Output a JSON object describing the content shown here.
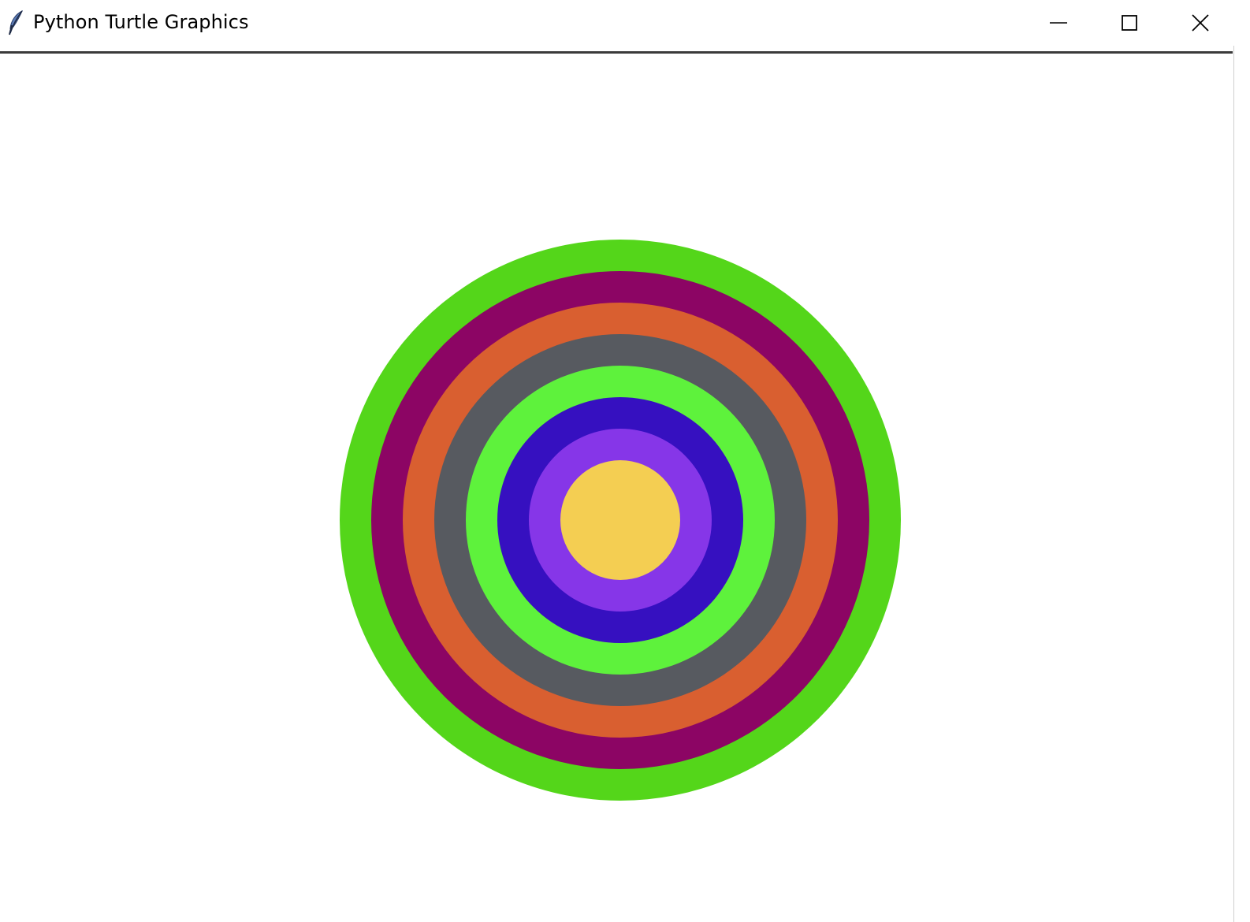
{
  "window": {
    "title": "Python Turtle Graphics",
    "app_icon": "feather-icon",
    "controls": {
      "minimize_icon": "minimize-icon",
      "maximize_icon": "maximize-icon",
      "close_icon": "close-icon"
    }
  },
  "canvas": {
    "background": "#ffffff",
    "rings": [
      {
        "name": "ring-1",
        "color": "#54d61a"
      },
      {
        "name": "ring-2",
        "color": "#8c0564"
      },
      {
        "name": "ring-3",
        "color": "#d95f30"
      },
      {
        "name": "ring-4",
        "color": "#575a60"
      },
      {
        "name": "ring-5",
        "color": "#5ef23c"
      },
      {
        "name": "ring-6",
        "color": "#3610c0"
      },
      {
        "name": "ring-7",
        "color": "#8636e8"
      },
      {
        "name": "ring-8",
        "color": "#f4ce52"
      }
    ]
  }
}
